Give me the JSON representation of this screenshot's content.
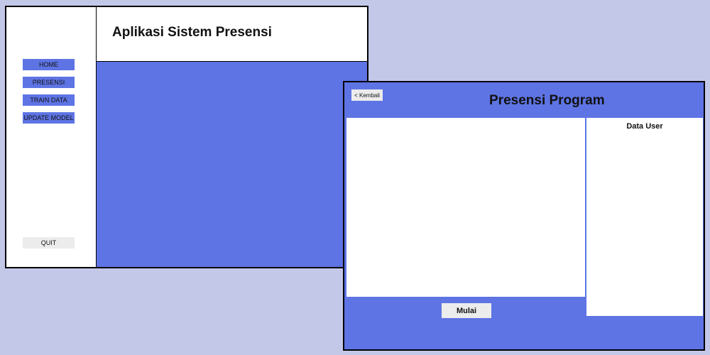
{
  "main_window": {
    "title": "Aplikasi Sistem Presensi",
    "menu": [
      {
        "label": "HOME"
      },
      {
        "label": "PRESENSI"
      },
      {
        "label": "TRAIN DATA"
      },
      {
        "label": "UPDATE MODEL"
      }
    ],
    "quit_label": "QUIT"
  },
  "presensi_window": {
    "back_label": "< Kembali",
    "title": "Presensi Program",
    "user_panel_title": "Data User",
    "start_label": "Mulai"
  },
  "colors": {
    "background": "#c4c8e8",
    "accent": "#5e74e4",
    "button_light": "#ececec"
  }
}
